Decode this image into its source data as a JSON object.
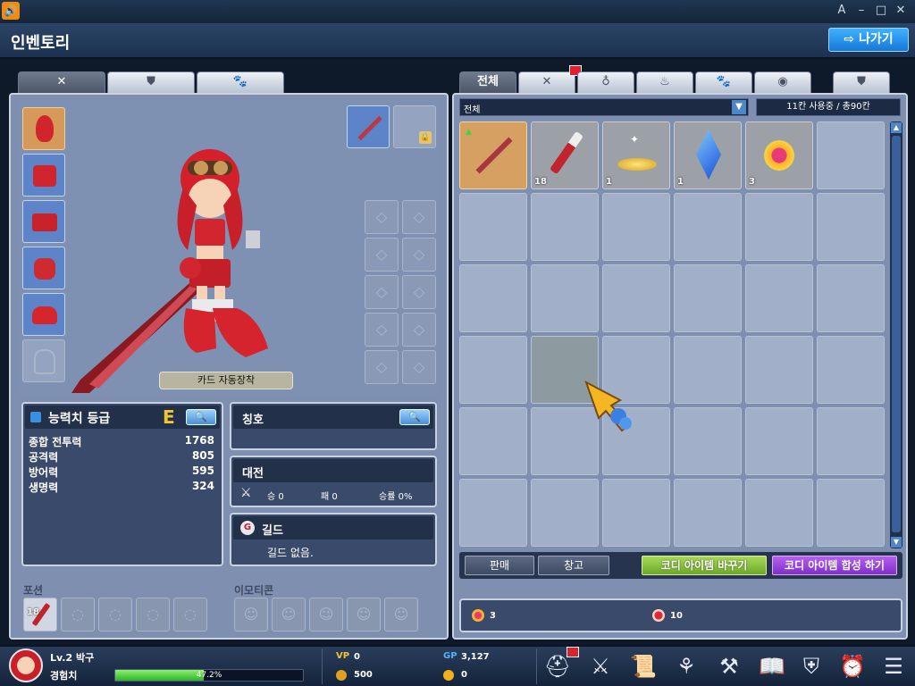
{
  "window": {
    "title_icon": "speaker-icon",
    "controls": [
      "A",
      "–",
      "□",
      "✕"
    ]
  },
  "header": {
    "title": "인벤토리",
    "exit_label": "나가기"
  },
  "left_tabs": [
    "crossed-swords-icon",
    "armor-icon",
    "paw-icon"
  ],
  "character": {
    "auto_equip_label": "카드 자동장착",
    "equip_slots_left": [
      "hair-icon",
      "top-icon",
      "bottom-icon",
      "gloves-icon",
      "shoes-icon",
      "cape-icon"
    ],
    "weapon_slots": [
      "sword-icon",
      "locked-weapon-icon"
    ]
  },
  "stats": {
    "title": "능력치 등급",
    "grade": "E",
    "rows": [
      {
        "label": "종합 전투력",
        "value": "1768"
      },
      {
        "label": "공격력",
        "value": "805"
      },
      {
        "label": "방어력",
        "value": "595"
      },
      {
        "label": "생명력",
        "value": "324"
      }
    ]
  },
  "title_box": {
    "title": "칭호"
  },
  "battle": {
    "title": "대전",
    "win": "승 0",
    "lose": "패 0",
    "rate": "승률 0%"
  },
  "guild": {
    "title": "길드",
    "text": "길드 없음."
  },
  "potion": {
    "label": "포션",
    "count": "18"
  },
  "emoticon": {
    "label": "이모티콘"
  },
  "inventory": {
    "tabs": [
      "전체",
      "crossed-swords-icon",
      "medal-icon",
      "potion-icon",
      "paw-icon",
      "bag-icon",
      "armor-icon"
    ],
    "filter": "전체",
    "capacity": "11칸 사용중 / 총90칸",
    "items": [
      {
        "name": "sword-item",
        "qty": ""
      },
      {
        "name": "potion-item",
        "qty": "18"
      },
      {
        "name": "gold-dust-item",
        "qty": "1"
      },
      {
        "name": "blue-crystal-item",
        "qty": "1"
      },
      {
        "name": "ring-item",
        "qty": "3"
      }
    ],
    "buttons": {
      "sell": "판매",
      "storage": "창고",
      "change": "코디 아이템 바꾸기",
      "combine": "코디 아이템 합성 하기"
    },
    "currency": [
      {
        "icon": "gem-icon",
        "value": "3"
      },
      {
        "icon": "token-icon",
        "value": "10"
      }
    ]
  },
  "bottom": {
    "level": "Lv.2 박구",
    "exp_label": "경험치",
    "exp_percent": "47.2%",
    "exp_fraction": 0.472,
    "vp": "0",
    "coin": "500",
    "gp": "3,127",
    "gold": "0",
    "vp_label": "VP",
    "gp_label": "GP"
  },
  "colors": {
    "accent": "#1677d8",
    "change_button": "#8cc63f",
    "combine_button": "#9b3fe0",
    "exp_bar": "#4fd24a"
  }
}
